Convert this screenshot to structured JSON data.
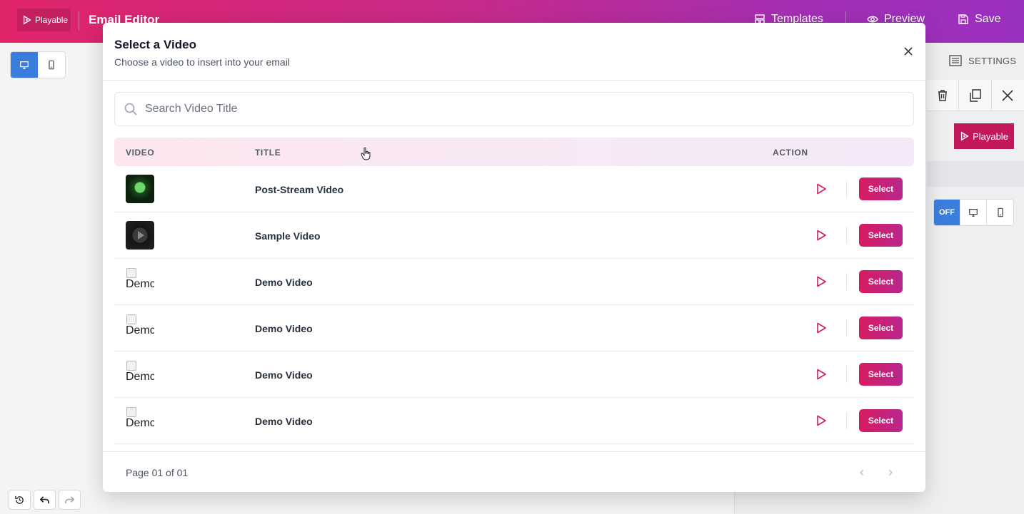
{
  "header": {
    "logo_text": "Playable",
    "app_title": "Email Editor",
    "templates_label": "Templates",
    "preview_label": "Preview",
    "save_label": "Save"
  },
  "editor": {
    "settings_label": "SETTINGS",
    "panel_logo_text": "Playable",
    "responsive_off_label": "OFF"
  },
  "modal": {
    "title": "Select a Video",
    "subtitle": "Choose a video to insert into your email",
    "search_placeholder": "Search Video Title",
    "columns": {
      "video": "VIDEO",
      "title": "TITLE",
      "action": "ACTION"
    },
    "rows": [
      {
        "thumb": "green",
        "title": "Post-Stream Video",
        "select_label": "Select"
      },
      {
        "thumb": "dark",
        "title": "Sample Video",
        "select_label": "Select"
      },
      {
        "thumb": "broken",
        "alt": "Demc",
        "title": "Demo Video",
        "select_label": "Select"
      },
      {
        "thumb": "broken",
        "alt": "Demc",
        "title": "Demo Video",
        "select_label": "Select"
      },
      {
        "thumb": "broken",
        "alt": "Demc",
        "title": "Demo Video",
        "select_label": "Select"
      },
      {
        "thumb": "broken",
        "alt": "Demc",
        "title": "Demo Video",
        "select_label": "Select"
      }
    ],
    "page_info": "Page 01 of 01"
  },
  "colors": {
    "brand_start": "#e0246a",
    "brand_end": "#9a30c0",
    "select_button": "#d81b60",
    "toggle_active": "#3b7ddd"
  }
}
